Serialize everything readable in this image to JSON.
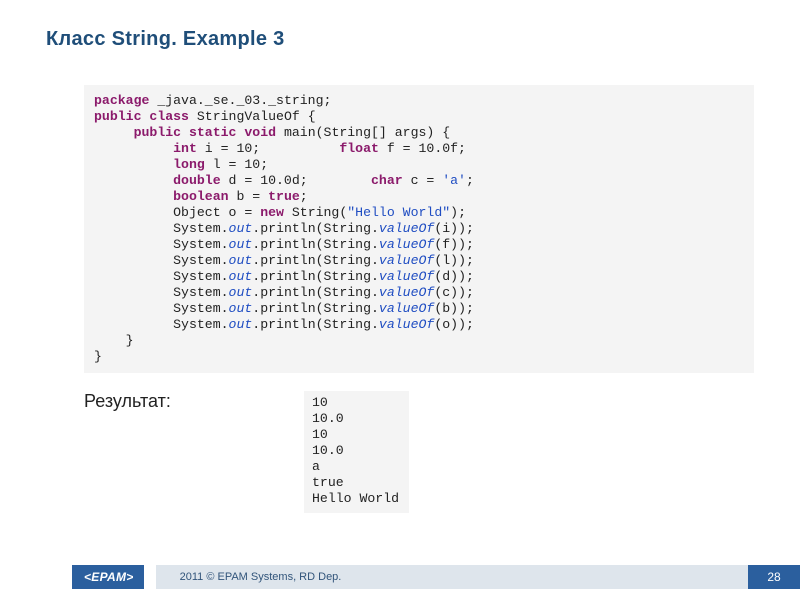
{
  "title": "Класс String. Example 3",
  "code": {
    "l1": {
      "kw1": "package",
      "rest": " _java._se._03._string;"
    },
    "l2": {
      "kw1": "public",
      "kw2": "class",
      "rest": " StringValueOf {"
    },
    "l3": {
      "kw1": "public",
      "kw2": "static",
      "kw3": "void",
      "rest": " main(String[] args) {"
    },
    "l4": {
      "kw1": "int",
      "rest1": " i = 10;          ",
      "kw2": "float",
      "rest2": " f = 10.0f;"
    },
    "l5": {
      "kw1": "long",
      "rest": " l = 10;"
    },
    "l6": {
      "kw1": "double",
      "rest1": " d = 10.0d;        ",
      "kw2": "char",
      "rest2": " c = ",
      "ch": "'a'",
      "semi": ";"
    },
    "l7": {
      "kw1": "boolean",
      "rest": " b = ",
      "kw2": "true",
      "semi": ";"
    },
    "l8": {
      "pre": "Object o = ",
      "kw1": "new",
      "mid": " String(",
      "str": "\"Hello World\"",
      "post": ");"
    },
    "p_pre": "System.",
    "p_out": "out",
    "p_mid": ".println(String.",
    "p_vo": "valueOf",
    "p9": "(i));",
    "p10": "(f));",
    "p11": "(l));",
    "p12": "(d));",
    "p13": "(c));",
    "p14": "(b));",
    "p15": "(o));",
    "close1": "    }",
    "close2": "}"
  },
  "resultLabel": "Результат:",
  "output": {
    "o1": "10",
    "o2": "10.0",
    "o3": "10",
    "o4": "10.0",
    "o5": "a",
    "o6": "true",
    "o7": "Hello World"
  },
  "footer": {
    "logo": "<EPAM>",
    "copyright": "2011 © EPAM Systems, RD Dep.",
    "page": "28"
  }
}
